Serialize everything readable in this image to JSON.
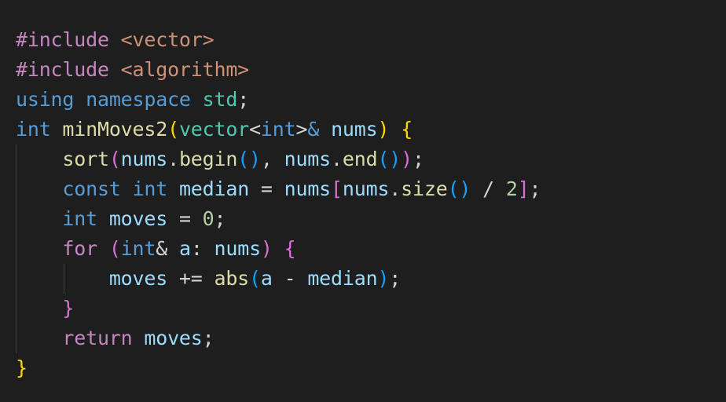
{
  "code": {
    "lines": [
      [
        {
          "t": "#include",
          "c": "pp"
        },
        {
          "t": " ",
          "c": "op"
        },
        {
          "t": "<vector>",
          "c": "str"
        }
      ],
      [
        {
          "t": "#include",
          "c": "pp"
        },
        {
          "t": " ",
          "c": "op"
        },
        {
          "t": "<algorithm>",
          "c": "str"
        }
      ],
      [
        {
          "t": "using",
          "c": "kw"
        },
        {
          "t": " ",
          "c": "op"
        },
        {
          "t": "namespace",
          "c": "kw"
        },
        {
          "t": " ",
          "c": "op"
        },
        {
          "t": "std",
          "c": "ns"
        },
        {
          "t": ";",
          "c": "op"
        }
      ],
      [
        {
          "t": "int",
          "c": "kw"
        },
        {
          "t": " ",
          "c": "op"
        },
        {
          "t": "minMoves2",
          "c": "fn"
        },
        {
          "t": "(",
          "c": "p1"
        },
        {
          "t": "vector",
          "c": "type"
        },
        {
          "t": "<",
          "c": "op"
        },
        {
          "t": "int",
          "c": "kw"
        },
        {
          "t": ">",
          "c": "op"
        },
        {
          "t": "&",
          "c": "kw"
        },
        {
          "t": " ",
          "c": "op"
        },
        {
          "t": "nums",
          "c": "var"
        },
        {
          "t": ")",
          "c": "p1"
        },
        {
          "t": " ",
          "c": "op"
        },
        {
          "t": "{",
          "c": "p1"
        }
      ],
      [
        {
          "t": "    ",
          "c": "op"
        },
        {
          "t": "sort",
          "c": "fn"
        },
        {
          "t": "(",
          "c": "p2"
        },
        {
          "t": "nums",
          "c": "var"
        },
        {
          "t": ".",
          "c": "op"
        },
        {
          "t": "begin",
          "c": "fn"
        },
        {
          "t": "()",
          "c": "p3"
        },
        {
          "t": ", ",
          "c": "op"
        },
        {
          "t": "nums",
          "c": "var"
        },
        {
          "t": ".",
          "c": "op"
        },
        {
          "t": "end",
          "c": "fn"
        },
        {
          "t": "()",
          "c": "p3"
        },
        {
          "t": ")",
          "c": "p2"
        },
        {
          "t": ";",
          "c": "op"
        }
      ],
      [
        {
          "t": "    ",
          "c": "op"
        },
        {
          "t": "const",
          "c": "kw"
        },
        {
          "t": " ",
          "c": "op"
        },
        {
          "t": "int",
          "c": "kw"
        },
        {
          "t": " ",
          "c": "op"
        },
        {
          "t": "median",
          "c": "var"
        },
        {
          "t": " = ",
          "c": "op"
        },
        {
          "t": "nums",
          "c": "var"
        },
        {
          "t": "[",
          "c": "p2"
        },
        {
          "t": "nums",
          "c": "var"
        },
        {
          "t": ".",
          "c": "op"
        },
        {
          "t": "size",
          "c": "fn"
        },
        {
          "t": "()",
          "c": "p3"
        },
        {
          "t": " / ",
          "c": "op"
        },
        {
          "t": "2",
          "c": "num"
        },
        {
          "t": "]",
          "c": "p2"
        },
        {
          "t": ";",
          "c": "op"
        }
      ],
      [
        {
          "t": "    ",
          "c": "op"
        },
        {
          "t": "int",
          "c": "kw"
        },
        {
          "t": " ",
          "c": "op"
        },
        {
          "t": "moves",
          "c": "var"
        },
        {
          "t": " = ",
          "c": "op"
        },
        {
          "t": "0",
          "c": "num"
        },
        {
          "t": ";",
          "c": "op"
        }
      ],
      [
        {
          "t": "    ",
          "c": "op"
        },
        {
          "t": "for",
          "c": "ctl"
        },
        {
          "t": " ",
          "c": "op"
        },
        {
          "t": "(",
          "c": "p2"
        },
        {
          "t": "int",
          "c": "kw"
        },
        {
          "t": "& ",
          "c": "op"
        },
        {
          "t": "a",
          "c": "var"
        },
        {
          "t": ": ",
          "c": "op"
        },
        {
          "t": "nums",
          "c": "var"
        },
        {
          "t": ")",
          "c": "p2"
        },
        {
          "t": " ",
          "c": "op"
        },
        {
          "t": "{",
          "c": "p2"
        }
      ],
      [
        {
          "t": "        ",
          "c": "op"
        },
        {
          "t": "moves",
          "c": "var"
        },
        {
          "t": " += ",
          "c": "op"
        },
        {
          "t": "abs",
          "c": "fn"
        },
        {
          "t": "(",
          "c": "p3"
        },
        {
          "t": "a",
          "c": "var"
        },
        {
          "t": " - ",
          "c": "op"
        },
        {
          "t": "median",
          "c": "var"
        },
        {
          "t": ")",
          "c": "p3"
        },
        {
          "t": ";",
          "c": "op"
        }
      ],
      [
        {
          "t": "    ",
          "c": "op"
        },
        {
          "t": "}",
          "c": "p2"
        }
      ],
      [
        {
          "t": "    ",
          "c": "op"
        },
        {
          "t": "return",
          "c": "ctl"
        },
        {
          "t": " ",
          "c": "op"
        },
        {
          "t": "moves",
          "c": "var"
        },
        {
          "t": ";",
          "c": "op"
        }
      ],
      [
        {
          "t": "}",
          "c": "p1"
        }
      ]
    ]
  }
}
